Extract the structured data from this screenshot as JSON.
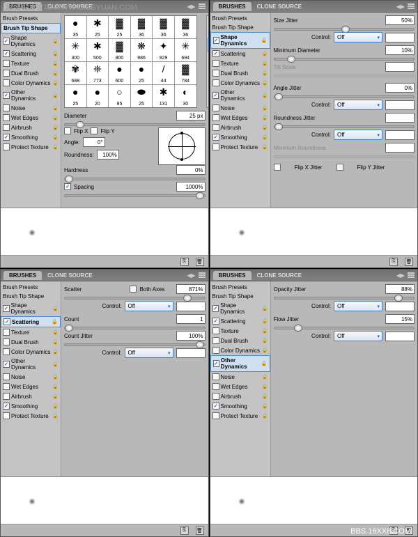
{
  "wm_top": "思维设计论坛 WWW.MISSYUAN.COM",
  "wm_bot": "BBS.16XX8.COM",
  "tabs": {
    "brushes": "BRUSHES",
    "clone": "CLONE SOURCE"
  },
  "sidebar": {
    "presets": "Brush Presets",
    "tipshape": "Brush Tip Shape",
    "shape": "Shape Dynamics",
    "scatter": "Scattering",
    "texture": "Texture",
    "dual": "Dual Brush",
    "colord": "Color Dynamics",
    "otherd": "Other Dynamics",
    "noise": "Noise",
    "wet": "Wet Edges",
    "air": "Airbrush",
    "smooth": "Smoothing",
    "protect": "Protect Texture"
  },
  "p1": {
    "brushes": [
      "35",
      "25",
      "25",
      "36",
      "36",
      "36",
      "300",
      "500",
      "800",
      "986",
      "929",
      "694",
      "688",
      "773",
      "600",
      "25",
      "44",
      "784",
      "25",
      "20",
      "95",
      "25",
      "131",
      "30"
    ],
    "diameter": "Diameter",
    "diameter_v": "25 px",
    "flipx": "Flip X",
    "flipy": "Flip Y",
    "angle": "Angle:",
    "angle_v": "0°",
    "round": "Roundness:",
    "round_v": "100%",
    "hard": "Hardness",
    "hard_v": "0%",
    "spacing": "Spacing",
    "spacing_v": "1000%"
  },
  "p2": {
    "size": "Size Jitter",
    "size_v": "50%",
    "control": "Control:",
    "off": "Off",
    "mindia": "Minimum Diameter",
    "mindia_v": "10%",
    "tilt": "Tilt Scale",
    "angj": "Angle Jitter",
    "angj_v": "0%",
    "roundj": "Roundness Jitter",
    "minr": "Minimum Roundness",
    "fxj": "Flip X Jitter",
    "fyj": "Flip Y Jitter"
  },
  "p3": {
    "scatter": "Scatter",
    "both": "Both Axes",
    "scatter_v": "871%",
    "count": "Count",
    "count_v": "1",
    "cj": "Count Jitter",
    "cj_v": "100%"
  },
  "p4": {
    "opj": "Opacity Jitter",
    "opj_v": "88%",
    "flj": "Flow Jitter",
    "flj_v": "15%"
  },
  "footer": {
    "new": "⎘",
    "del": "🗑"
  }
}
